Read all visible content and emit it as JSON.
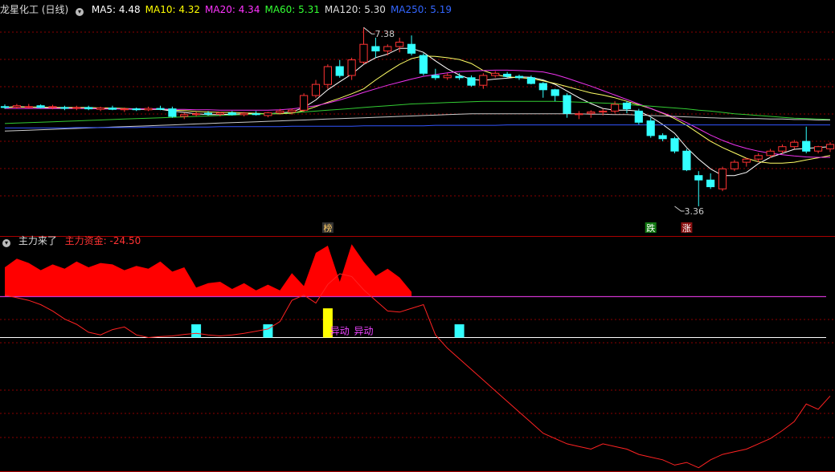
{
  "top_header": {
    "title": "龙星化工 (日线)",
    "indicators": [
      {
        "label": "MA5: 4.48",
        "color": "#ffffff"
      },
      {
        "label": "MA10: 4.32",
        "color": "#ffff00"
      },
      {
        "label": "MA20: 4.34",
        "color": "#ff33ff"
      },
      {
        "label": "MA60: 5.31",
        "color": "#33ff33"
      },
      {
        "label": "MA120: 5.30",
        "color": "#dddddd"
      },
      {
        "label": "MA250: 5.19",
        "color": "#3366ff"
      }
    ]
  },
  "bottom_header": {
    "title": "主力来了",
    "value_label": "主力资金: -24.50",
    "value_color": "#ff3333"
  },
  "colors": {
    "up": "#ff3333",
    "down": "#33ffff",
    "grid": "#8b0000",
    "ma5": "#ffffff",
    "ma10": "#ffff66",
    "ma20": "#ee33ee",
    "ma60": "#33cc33",
    "ma120": "#cccccc",
    "ma250": "#3355ff"
  },
  "chart_data": [
    {
      "type": "candlestick",
      "title": "龙星化工 (日线)",
      "ylim": [
        2.8,
        7.6
      ],
      "high_annotation": "7.38",
      "low_annotation": "3.36",
      "high_value": 7.38,
      "low_value": 3.36,
      "high_index": 30,
      "low_index": 56,
      "candles": [
        {
          "o": 5.6,
          "h": 5.65,
          "l": 5.55,
          "c": 5.58
        },
        {
          "o": 5.59,
          "h": 5.66,
          "l": 5.55,
          "c": 5.62
        },
        {
          "o": 5.6,
          "h": 5.66,
          "l": 5.56,
          "c": 5.6
        },
        {
          "o": 5.62,
          "h": 5.65,
          "l": 5.56,
          "c": 5.58
        },
        {
          "o": 5.58,
          "h": 5.64,
          "l": 5.54,
          "c": 5.6
        },
        {
          "o": 5.58,
          "h": 5.62,
          "l": 5.52,
          "c": 5.56
        },
        {
          "o": 5.56,
          "h": 5.62,
          "l": 5.52,
          "c": 5.58
        },
        {
          "o": 5.58,
          "h": 5.62,
          "l": 5.52,
          "c": 5.55
        },
        {
          "o": 5.54,
          "h": 5.6,
          "l": 5.5,
          "c": 5.57
        },
        {
          "o": 5.57,
          "h": 5.62,
          "l": 5.52,
          "c": 5.54
        },
        {
          "o": 5.53,
          "h": 5.58,
          "l": 5.48,
          "c": 5.55
        },
        {
          "o": 5.55,
          "h": 5.58,
          "l": 5.5,
          "c": 5.53
        },
        {
          "o": 5.53,
          "h": 5.6,
          "l": 5.5,
          "c": 5.56
        },
        {
          "o": 5.56,
          "h": 5.62,
          "l": 5.52,
          "c": 5.54
        },
        {
          "o": 5.55,
          "h": 5.6,
          "l": 5.35,
          "c": 5.38
        },
        {
          "o": 5.38,
          "h": 5.46,
          "l": 5.32,
          "c": 5.42
        },
        {
          "o": 5.42,
          "h": 5.48,
          "l": 5.38,
          "c": 5.44
        },
        {
          "o": 5.45,
          "h": 5.5,
          "l": 5.4,
          "c": 5.43
        },
        {
          "o": 5.43,
          "h": 5.48,
          "l": 5.38,
          "c": 5.46
        },
        {
          "o": 5.46,
          "h": 5.5,
          "l": 5.4,
          "c": 5.42
        },
        {
          "o": 5.42,
          "h": 5.48,
          "l": 5.38,
          "c": 5.45
        },
        {
          "o": 5.44,
          "h": 5.5,
          "l": 5.4,
          "c": 5.42
        },
        {
          "o": 5.4,
          "h": 5.48,
          "l": 5.36,
          "c": 5.46
        },
        {
          "o": 5.46,
          "h": 5.55,
          "l": 5.42,
          "c": 5.5
        },
        {
          "o": 5.48,
          "h": 5.56,
          "l": 5.42,
          "c": 5.52
        },
        {
          "o": 5.52,
          "h": 5.9,
          "l": 5.48,
          "c": 5.85
        },
        {
          "o": 5.85,
          "h": 6.2,
          "l": 5.8,
          "c": 6.1
        },
        {
          "o": 6.1,
          "h": 6.55,
          "l": 6.0,
          "c": 6.5
        },
        {
          "o": 6.5,
          "h": 6.65,
          "l": 6.25,
          "c": 6.3
        },
        {
          "o": 6.3,
          "h": 6.7,
          "l": 6.2,
          "c": 6.65
        },
        {
          "o": 6.6,
          "h": 7.38,
          "l": 6.55,
          "c": 7.0
        },
        {
          "o": 6.95,
          "h": 7.15,
          "l": 6.7,
          "c": 6.85
        },
        {
          "o": 6.85,
          "h": 7.0,
          "l": 6.75,
          "c": 6.95
        },
        {
          "o": 6.95,
          "h": 7.15,
          "l": 6.82,
          "c": 7.05
        },
        {
          "o": 7.0,
          "h": 7.2,
          "l": 6.75,
          "c": 6.8
        },
        {
          "o": 6.75,
          "h": 6.8,
          "l": 6.3,
          "c": 6.35
        },
        {
          "o": 6.3,
          "h": 6.45,
          "l": 6.2,
          "c": 6.25
        },
        {
          "o": 6.25,
          "h": 6.35,
          "l": 6.2,
          "c": 6.3
        },
        {
          "o": 6.28,
          "h": 6.35,
          "l": 6.2,
          "c": 6.25
        },
        {
          "o": 6.25,
          "h": 6.3,
          "l": 6.05,
          "c": 6.08
        },
        {
          "o": 6.08,
          "h": 6.35,
          "l": 6.0,
          "c": 6.3
        },
        {
          "o": 6.3,
          "h": 6.4,
          "l": 6.25,
          "c": 6.35
        },
        {
          "o": 6.33,
          "h": 6.38,
          "l": 6.25,
          "c": 6.28
        },
        {
          "o": 6.28,
          "h": 6.32,
          "l": 6.2,
          "c": 6.25
        },
        {
          "o": 6.25,
          "h": 6.3,
          "l": 6.1,
          "c": 6.12
        },
        {
          "o": 6.12,
          "h": 6.15,
          "l": 5.8,
          "c": 5.98
        },
        {
          "o": 5.98,
          "h": 6.0,
          "l": 5.72,
          "c": 5.85
        },
        {
          "o": 5.85,
          "h": 5.9,
          "l": 5.35,
          "c": 5.45
        },
        {
          "o": 5.42,
          "h": 5.5,
          "l": 5.32,
          "c": 5.44
        },
        {
          "o": 5.45,
          "h": 5.52,
          "l": 5.35,
          "c": 5.48
        },
        {
          "o": 5.48,
          "h": 5.55,
          "l": 5.4,
          "c": 5.5
        },
        {
          "o": 5.5,
          "h": 5.72,
          "l": 5.45,
          "c": 5.65
        },
        {
          "o": 5.68,
          "h": 5.72,
          "l": 5.45,
          "c": 5.55
        },
        {
          "o": 5.5,
          "h": 5.55,
          "l": 5.2,
          "c": 5.25
        },
        {
          "o": 5.28,
          "h": 5.35,
          "l": 4.9,
          "c": 4.95
        },
        {
          "o": 4.95,
          "h": 5.0,
          "l": 4.82,
          "c": 4.88
        },
        {
          "o": 4.88,
          "h": 4.92,
          "l": 4.55,
          "c": 4.6
        },
        {
          "o": 4.6,
          "h": 4.65,
          "l": 4.15,
          "c": 4.18
        },
        {
          "o": 4.05,
          "h": 4.15,
          "l": 3.36,
          "c": 3.95
        },
        {
          "o": 3.95,
          "h": 4.1,
          "l": 3.75,
          "c": 3.8
        },
        {
          "o": 3.75,
          "h": 4.25,
          "l": 3.7,
          "c": 4.2
        },
        {
          "o": 4.2,
          "h": 4.4,
          "l": 4.15,
          "c": 4.35
        },
        {
          "o": 4.35,
          "h": 4.45,
          "l": 4.25,
          "c": 4.42
        },
        {
          "o": 4.42,
          "h": 4.55,
          "l": 4.35,
          "c": 4.5
        },
        {
          "o": 4.5,
          "h": 4.65,
          "l": 4.45,
          "c": 4.6
        },
        {
          "o": 4.6,
          "h": 4.75,
          "l": 4.55,
          "c": 4.7
        },
        {
          "o": 4.7,
          "h": 4.85,
          "l": 4.65,
          "c": 4.8
        },
        {
          "o": 4.82,
          "h": 5.15,
          "l": 4.55,
          "c": 4.6
        },
        {
          "o": 4.6,
          "h": 4.72,
          "l": 4.55,
          "c": 4.7
        },
        {
          "o": 4.65,
          "h": 4.8,
          "l": 4.58,
          "c": 4.75
        }
      ],
      "series": [
        {
          "name": "MA5",
          "color_key": "ma5",
          "values": [
            5.58,
            5.6,
            5.59,
            5.58,
            5.57,
            5.57,
            5.57,
            5.56,
            5.55,
            5.55,
            5.55,
            5.54,
            5.54,
            5.54,
            5.5,
            5.47,
            5.44,
            5.42,
            5.42,
            5.43,
            5.44,
            5.44,
            5.44,
            5.46,
            5.48,
            5.58,
            5.75,
            5.98,
            6.16,
            6.33,
            6.55,
            6.7,
            6.78,
            6.91,
            6.91,
            6.82,
            6.63,
            6.45,
            6.31,
            6.21,
            6.19,
            6.22,
            6.24,
            6.27,
            6.26,
            6.2,
            6.1,
            5.95,
            5.8,
            5.67,
            5.56,
            5.52,
            5.52,
            5.5,
            5.37,
            5.2,
            5.0,
            4.68,
            4.42,
            4.2,
            4.05,
            4.05,
            4.12,
            4.32,
            4.46,
            4.55,
            4.64,
            4.66,
            4.68,
            4.7
          ]
        },
        {
          "name": "MA10",
          "color_key": "ma10",
          "values": [
            5.58,
            5.59,
            5.59,
            5.59,
            5.58,
            5.58,
            5.58,
            5.58,
            5.57,
            5.57,
            5.56,
            5.55,
            5.55,
            5.55,
            5.52,
            5.51,
            5.49,
            5.48,
            5.47,
            5.47,
            5.46,
            5.45,
            5.44,
            5.44,
            5.45,
            5.51,
            5.6,
            5.7,
            5.79,
            5.89,
            6.0,
            6.2,
            6.38,
            6.55,
            6.68,
            6.74,
            6.73,
            6.7,
            6.66,
            6.57,
            6.41,
            6.32,
            6.27,
            6.25,
            6.23,
            6.18,
            6.12,
            6.05,
            5.98,
            5.91,
            5.86,
            5.8,
            5.72,
            5.64,
            5.56,
            5.45,
            5.33,
            5.18,
            5.0,
            4.82,
            4.68,
            4.56,
            4.44,
            4.36,
            4.33,
            4.33,
            4.35,
            4.4,
            4.45,
            4.5
          ]
        },
        {
          "name": "MA20",
          "color_key": "ma20",
          "values": [
            5.56,
            5.56,
            5.56,
            5.56,
            5.56,
            5.56,
            5.56,
            5.56,
            5.55,
            5.55,
            5.55,
            5.55,
            5.55,
            5.55,
            5.54,
            5.54,
            5.53,
            5.53,
            5.52,
            5.52,
            5.52,
            5.52,
            5.52,
            5.53,
            5.55,
            5.58,
            5.62,
            5.68,
            5.75,
            5.83,
            5.92,
            6.0,
            6.08,
            6.15,
            6.22,
            6.28,
            6.32,
            6.36,
            6.39,
            6.4,
            6.41,
            6.42,
            6.42,
            6.41,
            6.4,
            6.38,
            6.32,
            6.24,
            6.15,
            6.06,
            5.96,
            5.86,
            5.76,
            5.66,
            5.56,
            5.46,
            5.36,
            5.24,
            5.1,
            4.96,
            4.84,
            4.74,
            4.66,
            4.6,
            4.55,
            4.52,
            4.49,
            4.47,
            4.46,
            4.46
          ]
        },
        {
          "name": "MA60",
          "color_key": "ma60",
          "values": [
            5.22,
            5.23,
            5.24,
            5.25,
            5.26,
            5.27,
            5.28,
            5.29,
            5.3,
            5.31,
            5.32,
            5.33,
            5.34,
            5.35,
            5.36,
            5.37,
            5.38,
            5.39,
            5.4,
            5.41,
            5.42,
            5.43,
            5.44,
            5.45,
            5.46,
            5.48,
            5.5,
            5.52,
            5.54,
            5.56,
            5.58,
            5.6,
            5.62,
            5.64,
            5.66,
            5.67,
            5.68,
            5.69,
            5.7,
            5.71,
            5.72,
            5.72,
            5.72,
            5.72,
            5.72,
            5.72,
            5.72,
            5.71,
            5.7,
            5.69,
            5.68,
            5.67,
            5.65,
            5.63,
            5.61,
            5.59,
            5.57,
            5.55,
            5.52,
            5.5,
            5.47,
            5.44,
            5.42,
            5.4,
            5.38,
            5.36,
            5.34,
            5.33,
            5.32,
            5.31
          ]
        },
        {
          "name": "MA120",
          "color_key": "ma120",
          "values": [
            5.05,
            5.06,
            5.07,
            5.08,
            5.09,
            5.1,
            5.11,
            5.12,
            5.13,
            5.14,
            5.15,
            5.16,
            5.17,
            5.18,
            5.19,
            5.2,
            5.21,
            5.22,
            5.23,
            5.24,
            5.25,
            5.26,
            5.27,
            5.28,
            5.29,
            5.3,
            5.31,
            5.32,
            5.33,
            5.34,
            5.35,
            5.36,
            5.37,
            5.38,
            5.39,
            5.4,
            5.41,
            5.42,
            5.43,
            5.44,
            5.44,
            5.44,
            5.44,
            5.44,
            5.44,
            5.44,
            5.44,
            5.44,
            5.44,
            5.43,
            5.43,
            5.42,
            5.42,
            5.41,
            5.4,
            5.39,
            5.38,
            5.37,
            5.36,
            5.35,
            5.34,
            5.34,
            5.33,
            5.33,
            5.32,
            5.32,
            5.31,
            5.31,
            5.3,
            5.3
          ]
        },
        {
          "name": "MA250",
          "color_key": "ma250",
          "values": [
            5.12,
            5.12,
            5.12,
            5.12,
            5.12,
            5.12,
            5.13,
            5.13,
            5.13,
            5.13,
            5.13,
            5.13,
            5.14,
            5.14,
            5.14,
            5.14,
            5.14,
            5.14,
            5.15,
            5.15,
            5.15,
            5.15,
            5.15,
            5.15,
            5.16,
            5.16,
            5.16,
            5.16,
            5.16,
            5.16,
            5.17,
            5.17,
            5.17,
            5.17,
            5.17,
            5.17,
            5.18,
            5.18,
            5.18,
            5.18,
            5.18,
            5.18,
            5.19,
            5.19,
            5.19,
            5.19,
            5.19,
            5.19,
            5.19,
            5.19,
            5.19,
            5.19,
            5.19,
            5.19,
            5.19,
            5.19,
            5.19,
            5.19,
            5.19,
            5.19,
            5.19,
            5.19,
            5.19,
            5.19,
            5.19,
            5.19,
            5.19,
            5.19,
            5.19,
            5.19
          ]
        }
      ],
      "markers": [
        {
          "text": "榜",
          "index": 27,
          "bg": "#333333",
          "fg": "#ffcc66"
        },
        {
          "text": "跌",
          "index": 54,
          "bg": "#117711",
          "fg": "#ffffff"
        },
        {
          "text": "涨",
          "index": 57,
          "bg": "#881111",
          "fg": "#ffffff"
        }
      ]
    },
    {
      "type": "indicator",
      "title": "主力来了",
      "value_label": "主力资金: -24.50",
      "area_values": [
        2.0,
        2.6,
        2.3,
        1.8,
        2.2,
        1.9,
        2.4,
        2.0,
        2.3,
        2.2,
        1.8,
        2.1,
        1.9,
        2.4,
        1.7,
        2.0,
        0.6,
        0.9,
        1.0,
        0.5,
        0.9,
        0.4,
        0.8,
        0.4,
        1.6,
        0.7,
        3.0,
        3.5,
        1.0,
        3.6,
        2.4,
        1.4,
        1.9,
        1.3,
        0.3
      ],
      "line_values": [
        8,
        7.5,
        7,
        6.2,
        5,
        3.5,
        2.5,
        1,
        0.5,
        1.5,
        2,
        0.5,
        0,
        0.2,
        0.3,
        0.6,
        0.8,
        0.5,
        0.3,
        0.5,
        0.8,
        1.2,
        1.6,
        3.0,
        7,
        8,
        6.5,
        10,
        12,
        11.5,
        9,
        7,
        5,
        4.8,
        5.5,
        6.2,
        0.5,
        -2,
        -4,
        -6,
        -8,
        -10,
        -12,
        -14,
        -16,
        -18,
        -19,
        -20,
        -20.5,
        -21,
        -20,
        -20.5,
        -21,
        -22,
        -22.5,
        -23,
        -24,
        -23.5,
        -24.5,
        -23,
        -22,
        -21.5,
        -21,
        -20,
        -19,
        -17.5,
        -15.8,
        -12.5,
        -13.5,
        -11
      ],
      "zero_line": 0,
      "ylim": [
        -25,
        17
      ],
      "bars": [
        {
          "index": 16,
          "value": 2.5,
          "color": "#33ffff"
        },
        {
          "index": 22,
          "value": 2.5,
          "color": "#33ffff"
        },
        {
          "index": 27,
          "value": 5.5,
          "color": "#ffff00"
        },
        {
          "index": 38,
          "value": 2.5,
          "color": "#33ffff"
        }
      ],
      "labels": [
        {
          "text": "异动",
          "index": 28,
          "color": "#ee44ff"
        },
        {
          "text": "异动",
          "index": 30,
          "color": "#ee44ff"
        }
      ]
    }
  ]
}
